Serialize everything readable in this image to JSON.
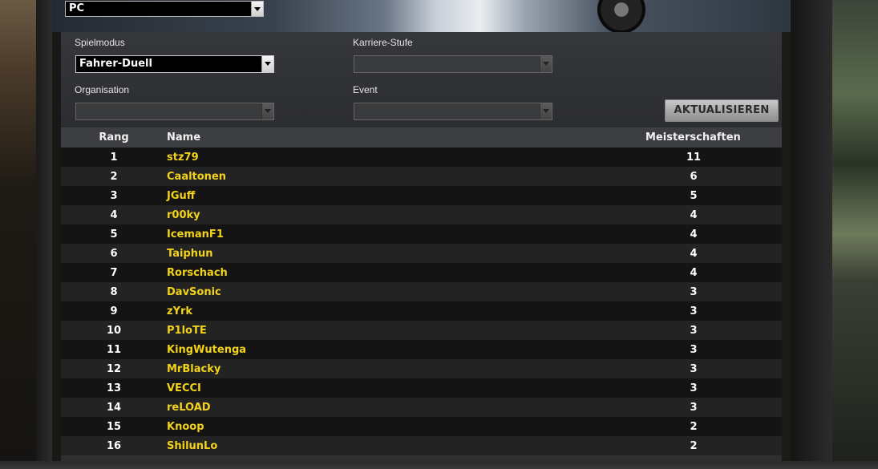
{
  "platform": {
    "selected": "PC"
  },
  "filters": {
    "spielmodus": {
      "label": "Spielmodus",
      "selected": "Fahrer-Duell"
    },
    "karriere_stufe": {
      "label": "Karriere-Stufe",
      "selected": ""
    },
    "organisation": {
      "label": "Organisation",
      "selected": ""
    },
    "event": {
      "label": "Event",
      "selected": ""
    },
    "refresh_label": "AKTUALISIEREN"
  },
  "table": {
    "headers": {
      "rank": "Rang",
      "name": "Name",
      "championships": "Meisterschaften"
    },
    "rows": [
      {
        "rank": "1",
        "name": "stz79",
        "championships": "11"
      },
      {
        "rank": "2",
        "name": "Caaltonen",
        "championships": "6"
      },
      {
        "rank": "3",
        "name": "JGuff",
        "championships": "5"
      },
      {
        "rank": "4",
        "name": "r00ky",
        "championships": "4"
      },
      {
        "rank": "5",
        "name": "IcemanF1",
        "championships": "4"
      },
      {
        "rank": "6",
        "name": "Taiphun",
        "championships": "4"
      },
      {
        "rank": "7",
        "name": "Rorschach",
        "championships": "4"
      },
      {
        "rank": "8",
        "name": "DavSonic",
        "championships": "3"
      },
      {
        "rank": "9",
        "name": "zYrk",
        "championships": "3"
      },
      {
        "rank": "10",
        "name": "P1loTE",
        "championships": "3"
      },
      {
        "rank": "11",
        "name": "KingWutenga",
        "championships": "3"
      },
      {
        "rank": "12",
        "name": "MrBlacky",
        "championships": "3"
      },
      {
        "rank": "13",
        "name": "VECCI",
        "championships": "3"
      },
      {
        "rank": "14",
        "name": "reLOAD",
        "championships": "3"
      },
      {
        "rank": "15",
        "name": "Knoop",
        "championships": "2"
      },
      {
        "rank": "16",
        "name": "ShilunLo",
        "championships": "2"
      }
    ]
  },
  "colors": {
    "name_text": "#f2d21a",
    "row_odd": "#141414",
    "row_even": "#232323",
    "header_bg": "#3c3e42",
    "panel_bg": "#2e2f31"
  }
}
